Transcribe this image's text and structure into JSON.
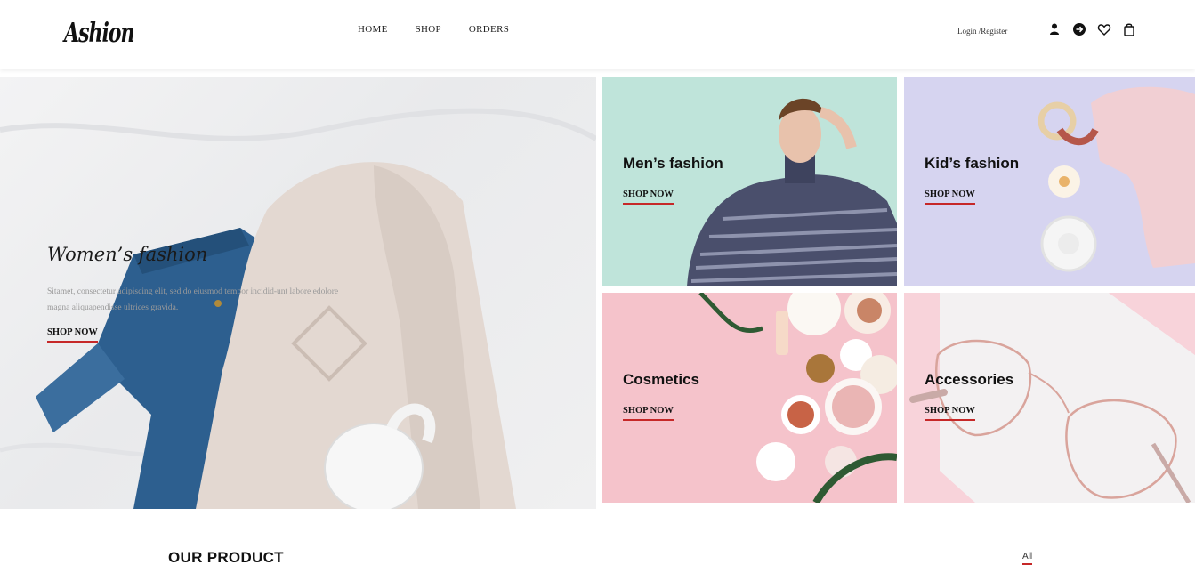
{
  "brand": {
    "logo": "Ashion"
  },
  "nav": {
    "items": [
      "HOME",
      "SHOP",
      "ORDERS"
    ]
  },
  "account": {
    "login_label": "Login /Register"
  },
  "icons": [
    "user-icon",
    "arrow-right-circle-icon",
    "heart-icon",
    "shopping-bag-icon"
  ],
  "hero": {
    "title": "Women’s fashion",
    "text": "Sitamet, consectetur adipiscing elit, sed do eiusmod tempor incidid-unt labore edolore magna aliquapendisse ultrices gravida.",
    "button": "SHOP NOW"
  },
  "categories": [
    {
      "title": "Men’s fashion",
      "button": "SHOP NOW"
    },
    {
      "title": "Kid’s fashion",
      "button": "SHOP NOW"
    },
    {
      "title": "Cosmetics",
      "button": "SHOP NOW"
    },
    {
      "title": "Accessories",
      "button": "SHOP NOW"
    }
  ],
  "products": {
    "title": "OUR PRODUCT",
    "filter_all": "All"
  },
  "colors": {
    "accent": "#c62828",
    "men_bg": "#bfe4da",
    "kid_bg": "#d6d4f0",
    "cosmetics_bg": "#f5c3cb",
    "accessories_bg": "#f8d3da"
  }
}
